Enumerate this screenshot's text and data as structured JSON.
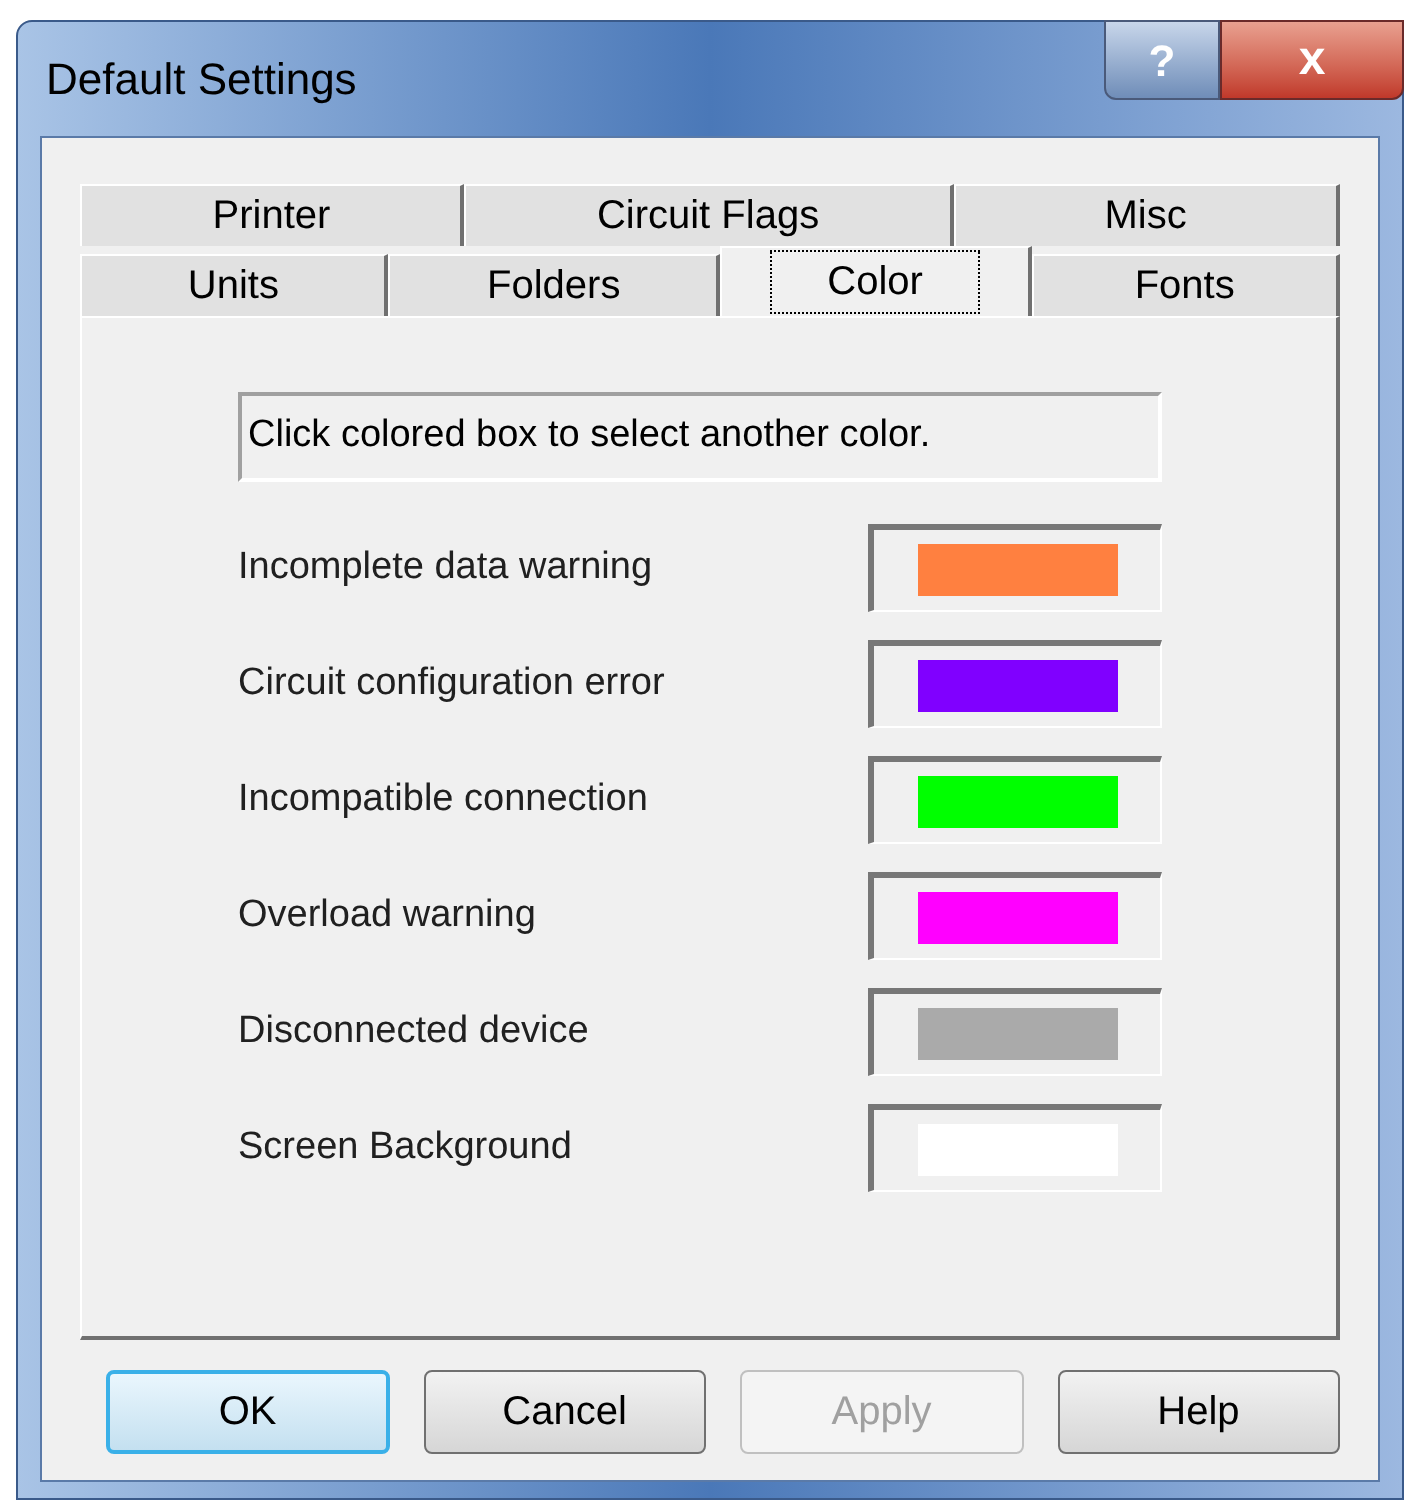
{
  "window": {
    "title": "Default Settings",
    "help_button": "?",
    "close_button": "x"
  },
  "tab_rows": [
    [
      {
        "label": "Printer",
        "selected": false
      },
      {
        "label": "Circuit Flags",
        "selected": false
      },
      {
        "label": "Misc",
        "selected": false
      }
    ],
    [
      {
        "label": "Units",
        "selected": false
      },
      {
        "label": "Folders",
        "selected": false
      },
      {
        "label": "Color",
        "selected": true
      },
      {
        "label": "Fonts",
        "selected": false
      }
    ]
  ],
  "hint": "Click colored box to select another color.",
  "colors": [
    {
      "label": "Incomplete data warning",
      "color": "#ff8040"
    },
    {
      "label": "Circuit configuration error",
      "color": "#8000ff"
    },
    {
      "label": "Incompatible connection",
      "color": "#00ff00"
    },
    {
      "label": "Overload warning",
      "color": "#ff00ff"
    },
    {
      "label": "Disconnected device",
      "color": "#aaaaaa"
    },
    {
      "label": "Screen Background",
      "color": "#ffffff"
    }
  ],
  "buttons": [
    {
      "label": "OK",
      "default": true,
      "disabled": false
    },
    {
      "label": "Cancel",
      "default": false,
      "disabled": false
    },
    {
      "label": "Apply",
      "default": false,
      "disabled": true
    },
    {
      "label": "Help",
      "default": false,
      "disabled": false
    }
  ]
}
